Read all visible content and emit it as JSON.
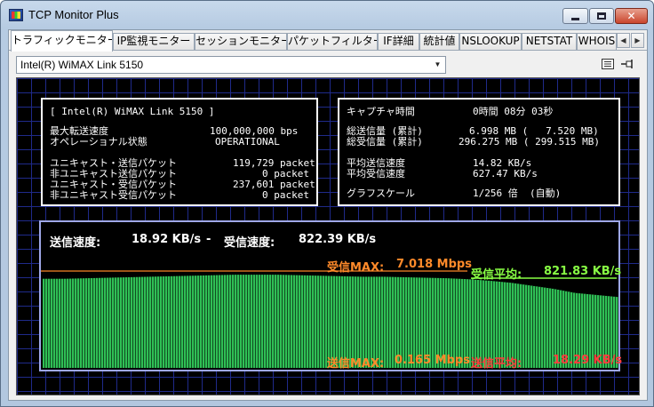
{
  "window": {
    "title": "TCP Monitor Plus"
  },
  "tabs": [
    "トラフィックモニター",
    "IP監視モニター",
    "セッションモニター",
    "パケットフィルター",
    "IF詳細",
    "統計値",
    "NSLOOKUP",
    "NETSTAT",
    "WHOIS"
  ],
  "tab_scroll": {
    "left": "◀",
    "right": "▶"
  },
  "adapter": {
    "selected": "Intel(R) WiMAX Link 5150"
  },
  "toolbar_icons": [
    "list-icon",
    "pin-icon"
  ],
  "left_box": {
    "header": "[ Intel(R) WiMAX Link 5150 ]",
    "rows": [
      {
        "label": "最大転送速度",
        "value": "100,000,000 bps"
      },
      {
        "label": "オペレーショナル状態",
        "value": "OPERATIONAL"
      },
      {
        "label": "ユニキャスト・送信パケット",
        "value": "119,729 packet"
      },
      {
        "label": "非ユニキャスト送信パケット",
        "value": "0 packet"
      },
      {
        "label": "ユニキャスト・受信パケット",
        "value": "237,601 packet"
      },
      {
        "label": "非ユニキャスト受信パケット",
        "value": "0 packet"
      }
    ]
  },
  "right_box": {
    "capture_label": "キャプチャ時間",
    "capture_value": "0時間 08分 03秒",
    "total_send_label": "総送信量 (累計)",
    "total_send_value": "6.998 MB (   7.520 MB)",
    "total_recv_label": "総受信量 (累計)",
    "total_recv_value": "296.275 MB ( 299.515 MB)",
    "avg_send_label": "平均送信速度",
    "avg_send_value": "14.82 KB/s",
    "avg_recv_label": "平均受信速度",
    "avg_recv_value": "627.47 KB/s",
    "scale_label": "グラフスケール",
    "scale_value": "1/256 倍  (自動)"
  },
  "graph": {
    "send_speed_label": "送信速度:",
    "send_speed_value": "18.92 KB/s",
    "separator": "-",
    "recv_speed_label": "受信速度:",
    "recv_speed_value": "822.39 KB/s",
    "recv_max_label": "受信MAX:",
    "recv_max_value": "7.018 Mbps",
    "recv_avg_label": "受信平均:",
    "recv_avg_value": "821.83 KB/s",
    "send_max_label": "送信MAX:",
    "send_max_value": "0.165 Mbps",
    "send_avg_label": "送信平均:",
    "send_avg_value": "18.29 KB/s",
    "colors": {
      "fill": "#2fbf55",
      "max_line": "#d07020",
      "avg_line": "#88ff44",
      "label_orange": "#ff8a2a",
      "label_green": "#88ff44",
      "label_red": "#ff3c3c"
    },
    "recv_series_kbps_relative": [
      0.88,
      0.88,
      0.885,
      0.89,
      0.895,
      0.9,
      0.905,
      0.91,
      0.915,
      0.92,
      0.92,
      0.92,
      0.915,
      0.91,
      0.905,
      0.9,
      0.9,
      0.895,
      0.89,
      0.885,
      0.875,
      0.86,
      0.84,
      0.81,
      0.78,
      0.74,
      0.72,
      0.7
    ]
  }
}
